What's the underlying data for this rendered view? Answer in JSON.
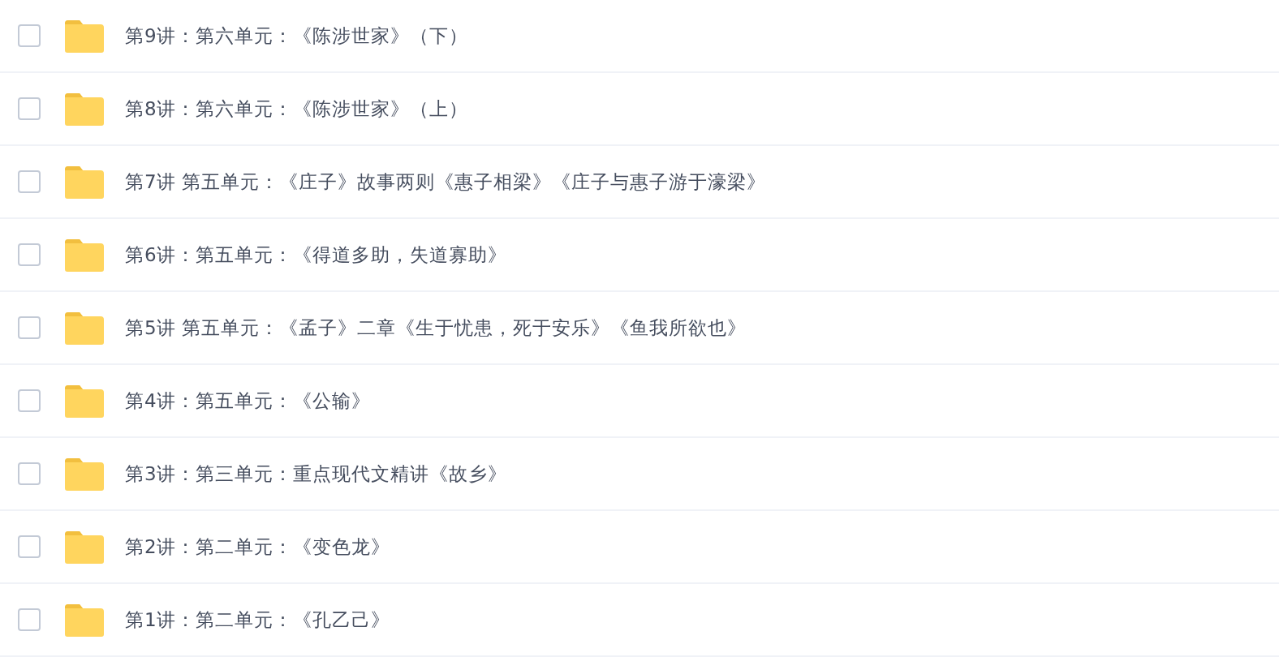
{
  "files": [
    {
      "name": "第9讲：第六单元：《陈涉世家》（下）",
      "checked": false
    },
    {
      "name": "第8讲：第六单元：《陈涉世家》（上）",
      "checked": false
    },
    {
      "name": "第7讲 第五单元：《庄子》故事两则《惠子相梁》《庄子与惠子游于濠梁》",
      "checked": false
    },
    {
      "name": "第6讲：第五单元：《得道多助，失道寡助》",
      "checked": false
    },
    {
      "name": "第5讲 第五单元：《孟子》二章《生于忧患，死于安乐》《鱼我所欲也》",
      "checked": false
    },
    {
      "name": "第4讲：第五单元：《公输》",
      "checked": false
    },
    {
      "name": "第3讲：第三单元：重点现代文精讲《故乡》",
      "checked": false
    },
    {
      "name": "第2讲：第二单元：《变色龙》",
      "checked": false
    },
    {
      "name": "第1讲：第二单元：《孔乙己》",
      "checked": false
    }
  ]
}
